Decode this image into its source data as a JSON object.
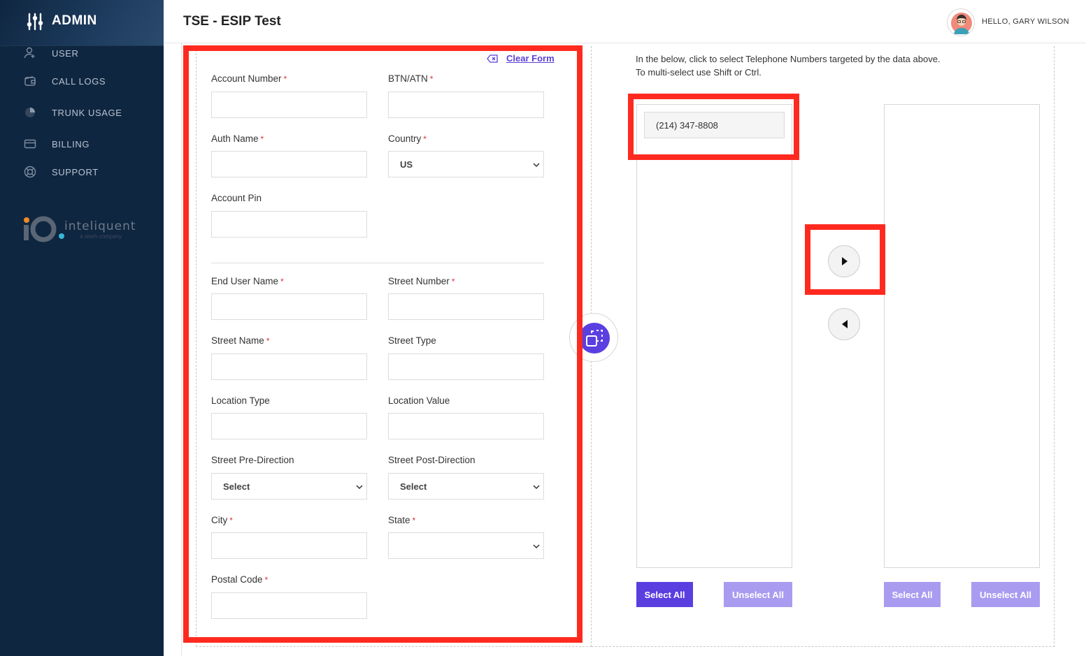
{
  "sidebar": {
    "brand": "ADMIN",
    "items": [
      {
        "label": "USER",
        "icon": "user-icon"
      },
      {
        "label": "CALL LOGS",
        "icon": "wallet-icon"
      },
      {
        "label": "TRUNK USAGE",
        "icon": "pie-chart-icon"
      },
      {
        "label": "BILLING",
        "icon": "credit-card-icon"
      },
      {
        "label": "SUPPORT",
        "icon": "lifebuoy-icon"
      }
    ],
    "logo": {
      "name": "inteliquent",
      "tagline": "a sinch company"
    }
  },
  "header": {
    "title": "TSE - ESIP Test",
    "greeting": "HELLO, GARY WILSON"
  },
  "form": {
    "clear_label": "Clear Form",
    "required_mark": "*",
    "account_number": {
      "label": "Account Number",
      "value": ""
    },
    "btn_atn": {
      "label": "BTN/ATN",
      "value": ""
    },
    "auth_name": {
      "label": "Auth Name",
      "value": ""
    },
    "country": {
      "label": "Country",
      "value": "US"
    },
    "account_pin": {
      "label": "Account Pin",
      "value": ""
    },
    "end_user_name": {
      "label": "End User Name",
      "value": ""
    },
    "street_number": {
      "label": "Street Number",
      "value": ""
    },
    "street_name": {
      "label": "Street Name",
      "value": ""
    },
    "street_type": {
      "label": "Street Type",
      "value": ""
    },
    "location_type": {
      "label": "Location Type",
      "value": ""
    },
    "location_value": {
      "label": "Location Value",
      "value": ""
    },
    "street_pre_direction": {
      "label": "Street Pre-Direction",
      "value": "Select"
    },
    "street_post_direction": {
      "label": "Street Post-Direction",
      "value": "Select"
    },
    "city": {
      "label": "City",
      "value": ""
    },
    "state": {
      "label": "State",
      "value": ""
    },
    "postal_code": {
      "label": "Postal Code",
      "value": ""
    }
  },
  "tn_selector": {
    "instruction_line1": "In the below, click to select Telephone Numbers targeted by the data above.",
    "instruction_line2": "To multi-select use Shift or Ctrl.",
    "available": [
      "(214) 347-8808"
    ],
    "selected": [],
    "left_select_all": "Select All",
    "left_unselect_all": "Unselect All",
    "right_select_all": "Select All",
    "right_unselect_all": "Unselect All"
  },
  "colors": {
    "sidebar_bg": "#0f2640",
    "accent": "#5a3ee0",
    "accent_light": "#a99bf0",
    "highlight": "#ff2a1f",
    "required": "#e0303a"
  }
}
